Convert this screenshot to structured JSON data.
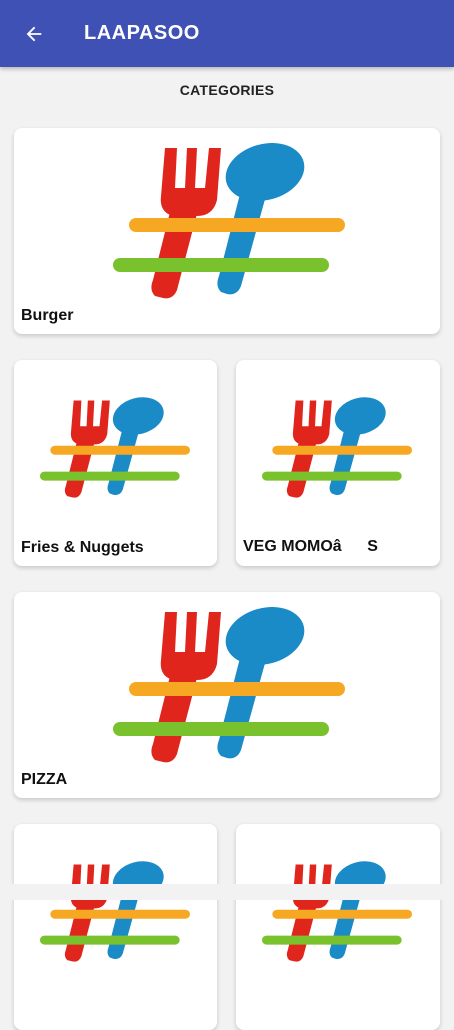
{
  "app": {
    "title": "LAAPASOO",
    "back_icon": "arrow-left-icon",
    "bar_color": "#3f51b5"
  },
  "section": {
    "title": "CATEGORIES"
  },
  "logo_icon": "fork-spoon-hash-icon",
  "logo_colors": {
    "fork": "#e0261c",
    "spoon": "#1b8bc7",
    "top_bar": "#f7a823",
    "bottom_bar": "#7ac12e"
  },
  "categories": [
    {
      "label": "Burger"
    },
    {
      "label": "Fries & Nuggets"
    },
    {
      "label": "VEG MOMOâS"
    },
    {
      "label": "PIZZA"
    },
    {
      "label": ""
    },
    {
      "label": ""
    }
  ]
}
